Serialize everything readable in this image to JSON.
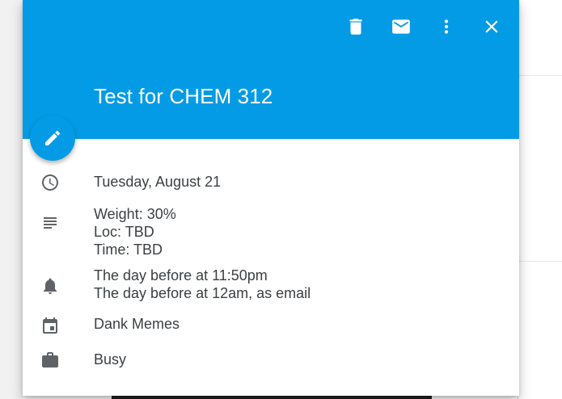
{
  "event": {
    "title": "Test for CHEM 312",
    "date": "Tuesday, August 21",
    "description": [
      "Weight: 30%",
      "Loc: TBD",
      "Time: TBD"
    ],
    "notifications": [
      "The day before at 11:50pm",
      "The day before at 12am, as email"
    ],
    "calendar": "Dank Memes",
    "availability": "Busy"
  },
  "toolbar": {
    "icons": [
      "trash-icon",
      "email-icon",
      "more-vert-icon",
      "close-icon"
    ]
  },
  "colors": {
    "header": "#039be5",
    "text": "#3c4043",
    "icon": "#5f6368"
  }
}
